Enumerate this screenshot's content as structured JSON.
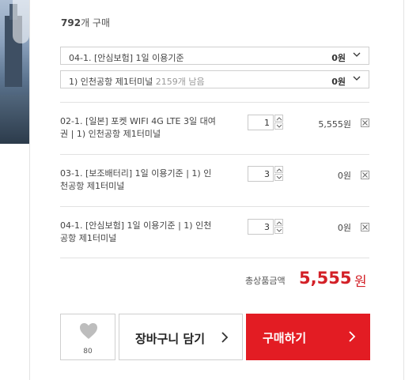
{
  "summary": {
    "count": "792",
    "count_suffix": "개 구매"
  },
  "options": [
    {
      "label": "04-1. [안심보험] 1일 이용기준",
      "remain": "",
      "price": "0원"
    },
    {
      "label": "1) 인천공항 제1터미널",
      "remain": " 2159개 남음",
      "price": "0원"
    }
  ],
  "items": [
    {
      "name": "02-1. [일본] 포켓 WIFI 4G LTE 3일 대여권 | 1) 인천공항 제1터미널",
      "qty": "1",
      "price": "5,555원"
    },
    {
      "name": "03-1. [보조배터리] 1일 이용기준 | 1) 인천공항 제1터미널",
      "qty": "3",
      "price": "0원"
    },
    {
      "name": "04-1. [안심보험] 1일 이용기준 | 1) 인천공항 제1터미널",
      "qty": "3",
      "price": "0원"
    }
  ],
  "total": {
    "label": "총상품금액",
    "value": "5,555",
    "unit": "원"
  },
  "actions": {
    "like_count": "80",
    "cart_label": "장바구니 담기",
    "buy_label": "구매하기"
  },
  "colors": {
    "accent": "#e31c23",
    "total_text": "#d32027"
  },
  "icons": {
    "select_arrow": "chevron-down-icon",
    "remove": "close-icon",
    "like": "heart-icon",
    "action_arrow": "chevron-right-icon"
  }
}
